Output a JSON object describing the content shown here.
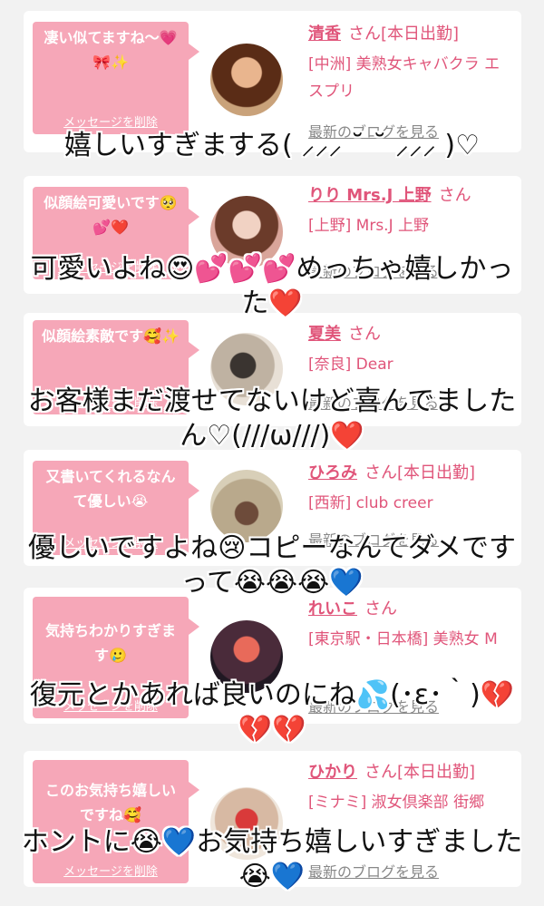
{
  "delete_label": "メッセージを削除",
  "blog_label": "最新のブログを見る",
  "colors": {
    "accent": "#e0557a",
    "bubble": "#f6a7b8",
    "background": "#f2f2f2"
  },
  "cards": [
    {
      "message": "凄い似てますね〜💗🎀✨",
      "name": "清香",
      "suffix": "さん[本日出勤]",
      "shop": "[中洲] 美熟女キャバクラ エスプリ"
    },
    {
      "message": "似顔絵可愛いです🥺💕❤️",
      "name": "りり Mrs.J 上野",
      "suffix": "さん",
      "shop": "[上野] Mrs.J 上野"
    },
    {
      "message": "似顔絵素敵です🥰✨",
      "name": "夏美",
      "suffix": "さん",
      "shop": "[奈良] Dear"
    },
    {
      "message": "又書いてくれるなんて優しい😭",
      "name": "ひろみ",
      "suffix": "さん[本日出勤]",
      "shop": "[西新] club creer"
    },
    {
      "message": "気持ちわかりすぎます🥲",
      "name": "れいこ",
      "suffix": "さん",
      "shop": "[東京駅・日本橋] 美熟女 M"
    },
    {
      "message": "このお気持ち嬉しいですね🥰",
      "name": "ひかり",
      "suffix": "さん[本日出勤]",
      "shop": "[ミナミ] 淑女倶楽部 街郷"
    }
  ],
  "captions": [
    [
      "嬉しいすぎまする( ⸝⸝⸝ ˘ ˘ ⸝⸝⸝ )♡"
    ],
    [
      "可愛いよね😍💕💕💕めっちゃ嬉しかっ",
      "た❤️"
    ],
    [
      "お客様まだ渡せてないけど喜んでました",
      "ん♡(///ω///)❤️"
    ],
    [
      "優しいですよね😢コピーなんてダメです",
      "って😭😭😭💙"
    ],
    [
      "復元とかあれば良いのにね💦(･ε･｀)💔",
      "💔💔"
    ],
    [
      "ホントに😭💙お気持ち嬉しいすぎました",
      "😭💙"
    ]
  ]
}
